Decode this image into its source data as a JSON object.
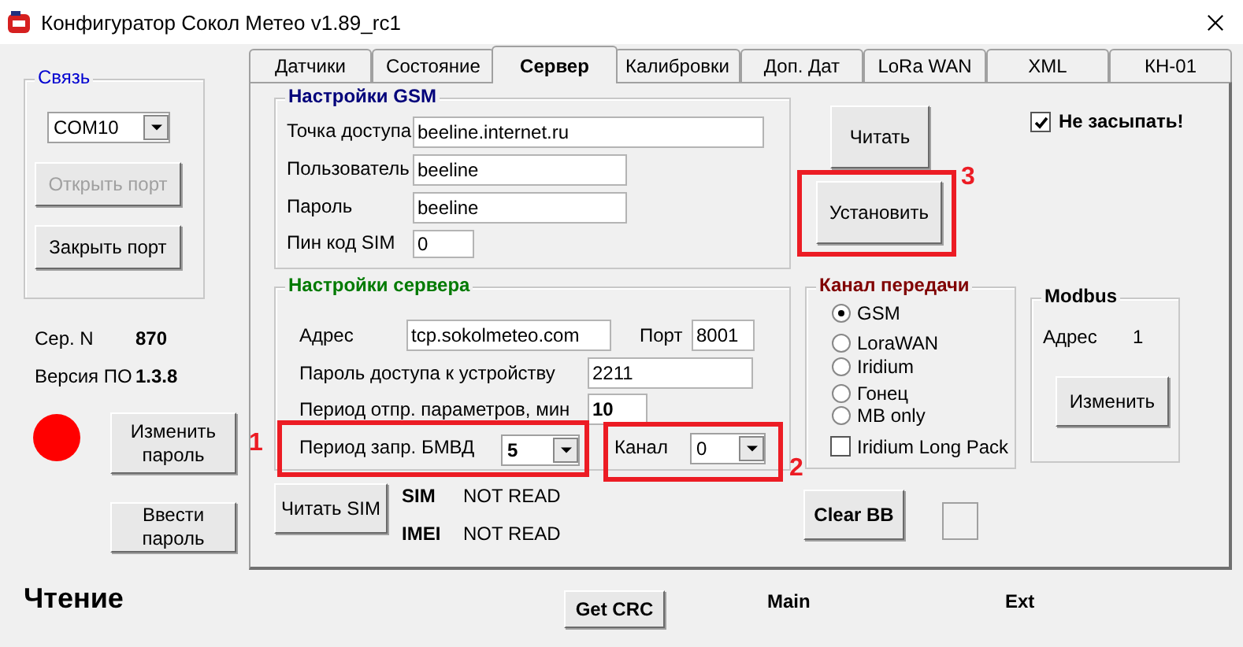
{
  "window": {
    "title": "Конфигуратор Сокол Метео v1.89_rc1"
  },
  "connection": {
    "title": "Связь",
    "port": "COM10",
    "buttons": [
      {
        "label": "Открыть порт",
        "disabled": true
      },
      {
        "label": "Закрыть порт",
        "disabled": false
      }
    ]
  },
  "device": {
    "serial_label": "Сер. N",
    "serial": "870",
    "version_label": "Версия ПО",
    "version": "1.3.8"
  },
  "password_buttons": [
    "Изменить пароль",
    "Ввести пароль"
  ],
  "status": "Чтение",
  "tabs": [
    {
      "label": "Датчики",
      "selected": false
    },
    {
      "label": "Состояние",
      "selected": false
    },
    {
      "label": "Сервер",
      "selected": true
    },
    {
      "label": "Калибровки",
      "selected": false
    },
    {
      "label": "Доп. Дат",
      "selected": false
    },
    {
      "label": "LoRa WAN",
      "selected": false
    },
    {
      "label": "XML",
      "selected": false
    },
    {
      "label": "КН-01",
      "selected": false
    }
  ],
  "gsm": {
    "title": "Настройки GSM",
    "fields": [
      {
        "label": "Точка доступа",
        "value": "beeline.internet.ru"
      },
      {
        "label": "Пользователь",
        "value": "beeline"
      },
      {
        "label": "Пароль",
        "value": "beeline"
      },
      {
        "label": "Пин код SIM",
        "value": "0"
      }
    ]
  },
  "server": {
    "title": "Настройки сервера",
    "address": {
      "label": "Адрес",
      "value": "tcp.sokolmeteo.com"
    },
    "port": {
      "label": "Порт",
      "value": "8001"
    },
    "device_password": {
      "label": "Пароль доступа к устройству",
      "value": "2211"
    },
    "send_period": {
      "label": "Период отпр. параметров, мин",
      "value": "10"
    },
    "poll_period": {
      "label": "Период запр.  БМВД",
      "value": "5"
    },
    "channel": {
      "label": "Канал",
      "value": "0"
    }
  },
  "read_sim_button": "Читать SIM",
  "sim": {
    "label": "SIM",
    "value": "NOT READ"
  },
  "imei": {
    "label": "IMEI",
    "value": "NOT READ"
  },
  "read_button": "Читать",
  "set_button": "Установить",
  "no_sleep": {
    "label": "Не засыпать!",
    "checked": true
  },
  "transmission": {
    "title": "Канал передачи",
    "options": [
      {
        "label": "GSM",
        "selected": true
      },
      {
        "label": "LoraWAN",
        "selected": false
      },
      {
        "label": "Iridium",
        "selected": false
      },
      {
        "label": "Гонец",
        "selected": false
      },
      {
        "label": "MB only",
        "selected": false
      }
    ],
    "long_pack": {
      "label": "Iridium Long Pack",
      "checked": false
    }
  },
  "modbus": {
    "title": "Modbus",
    "address_label": "Адрес",
    "address": "1",
    "change_button": "Изменить"
  },
  "clear_button": "Clear BB",
  "crc_button": "Get CRC",
  "main_label": "Main",
  "ext_label": "Ext",
  "annotations": [
    {
      "label": "1"
    },
    {
      "label": "2"
    },
    {
      "label": "3"
    }
  ]
}
